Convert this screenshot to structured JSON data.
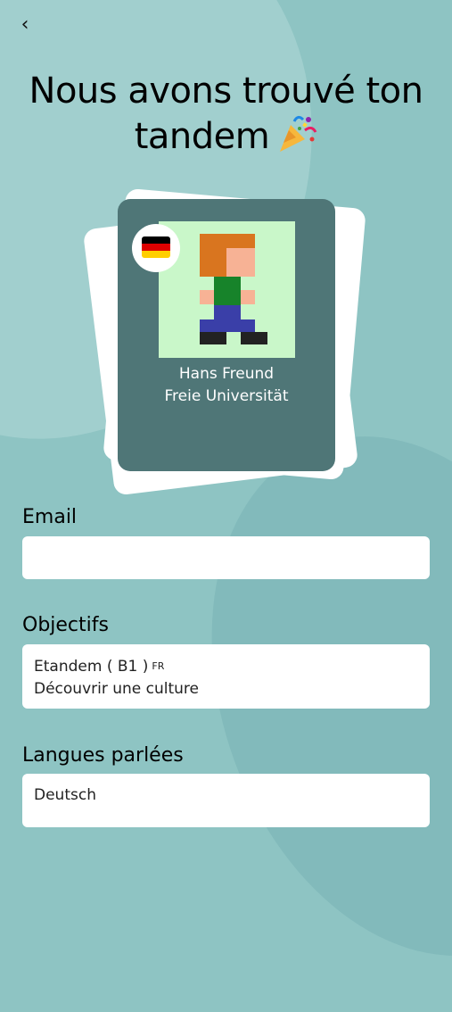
{
  "header": {
    "back_icon": "chevron-left-icon",
    "title_line1": "Nous avons trouvé ton",
    "title_line2": "tandem",
    "title_emoji_icon": "party-popper-icon"
  },
  "profile_card": {
    "flag_icon": "germany-flag-icon",
    "name": "Hans Freund",
    "university": "Freie Universität"
  },
  "email": {
    "label": "Email",
    "value": ""
  },
  "objectives": {
    "label": "Objectifs",
    "line1_main": "Etandem ( B1 )",
    "line1_lang": "FR",
    "line2": "Découvrir une culture"
  },
  "languages": {
    "label": "Langues parlées",
    "value": "Deutsch"
  },
  "colors": {
    "background": "#8ec4c3",
    "card": "#4f7677",
    "avatar_bg": "#c9f7c9"
  }
}
